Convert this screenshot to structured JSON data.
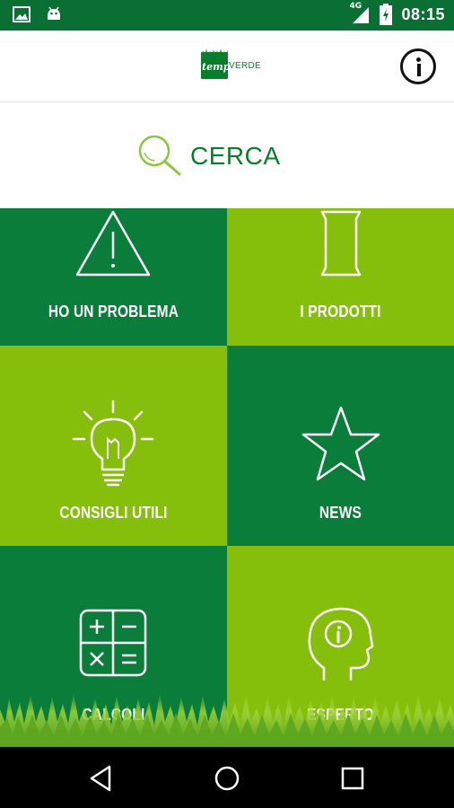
{
  "status_bar": {
    "time": "08:15",
    "network": "4G",
    "icons": [
      "image-notification-icon",
      "android-notification-icon",
      "signal-icon",
      "battery-charging-icon"
    ]
  },
  "app_bar": {
    "logo_text_left": "temp",
    "logo_text_right": "VERDE",
    "info_icon": "info-icon"
  },
  "search": {
    "label": "CERCA",
    "icon": "search-icon"
  },
  "tiles": [
    {
      "label": "HO UN PROBLEMA",
      "icon": "warning-icon",
      "color": "#0a7d3a"
    },
    {
      "label": "I PRODOTTI",
      "icon": "product-bag-icon",
      "color": "#85bf0b"
    },
    {
      "label": "CONSIGLI UTILI",
      "icon": "lightbulb-icon",
      "color": "#85bf0b"
    },
    {
      "label": "NEWS",
      "icon": "star-icon",
      "color": "#0a7d3a"
    },
    {
      "label": "CALCOLI",
      "icon": "calculator-icon",
      "color": "#0a7d3a"
    },
    {
      "label": "ESPERTO",
      "icon": "expert-head-icon",
      "color": "#85bf0b"
    }
  ],
  "nav_bar": {
    "buttons": [
      "back-icon",
      "home-icon",
      "recents-icon"
    ]
  },
  "colors": {
    "status_bar": "#0a6f32",
    "dark_green": "#0a7d3a",
    "light_green": "#85bf0b",
    "accent_text": "#0a7d2c"
  }
}
